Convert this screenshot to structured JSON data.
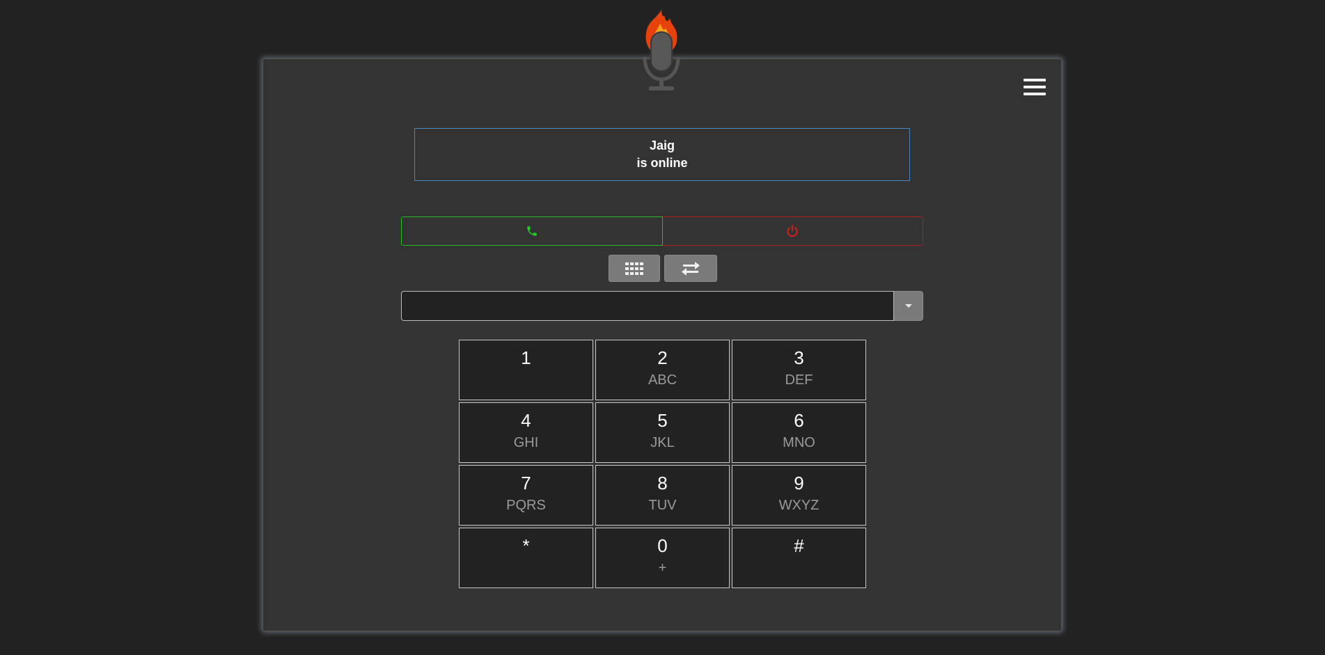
{
  "app": {
    "menu_icon": "hamburger-menu-icon",
    "logo_icon": "flaming-microphone-logo"
  },
  "status": {
    "name": "Jaig",
    "text": "is online",
    "border_color": "#4a86c0"
  },
  "call_controls": {
    "call_icon": "phone-icon",
    "hangup_icon": "power-icon",
    "call_color": "#22bb22",
    "hangup_color": "#b01e1e"
  },
  "tools": {
    "keypad_icon": "keypad-grid-icon",
    "transfer_icon": "transfer-arrows-icon"
  },
  "dial_input": {
    "value": "",
    "placeholder": ""
  },
  "keypad": [
    {
      "digit": "1",
      "letters": ""
    },
    {
      "digit": "2",
      "letters": "ABC"
    },
    {
      "digit": "3",
      "letters": "DEF"
    },
    {
      "digit": "4",
      "letters": "GHI"
    },
    {
      "digit": "5",
      "letters": "JKL"
    },
    {
      "digit": "6",
      "letters": "MNO"
    },
    {
      "digit": "7",
      "letters": "PQRS"
    },
    {
      "digit": "8",
      "letters": "TUV"
    },
    {
      "digit": "9",
      "letters": "WXYZ"
    },
    {
      "digit": "*",
      "letters": ""
    },
    {
      "digit": "0",
      "letters": "+"
    },
    {
      "digit": "#",
      "letters": ""
    }
  ]
}
